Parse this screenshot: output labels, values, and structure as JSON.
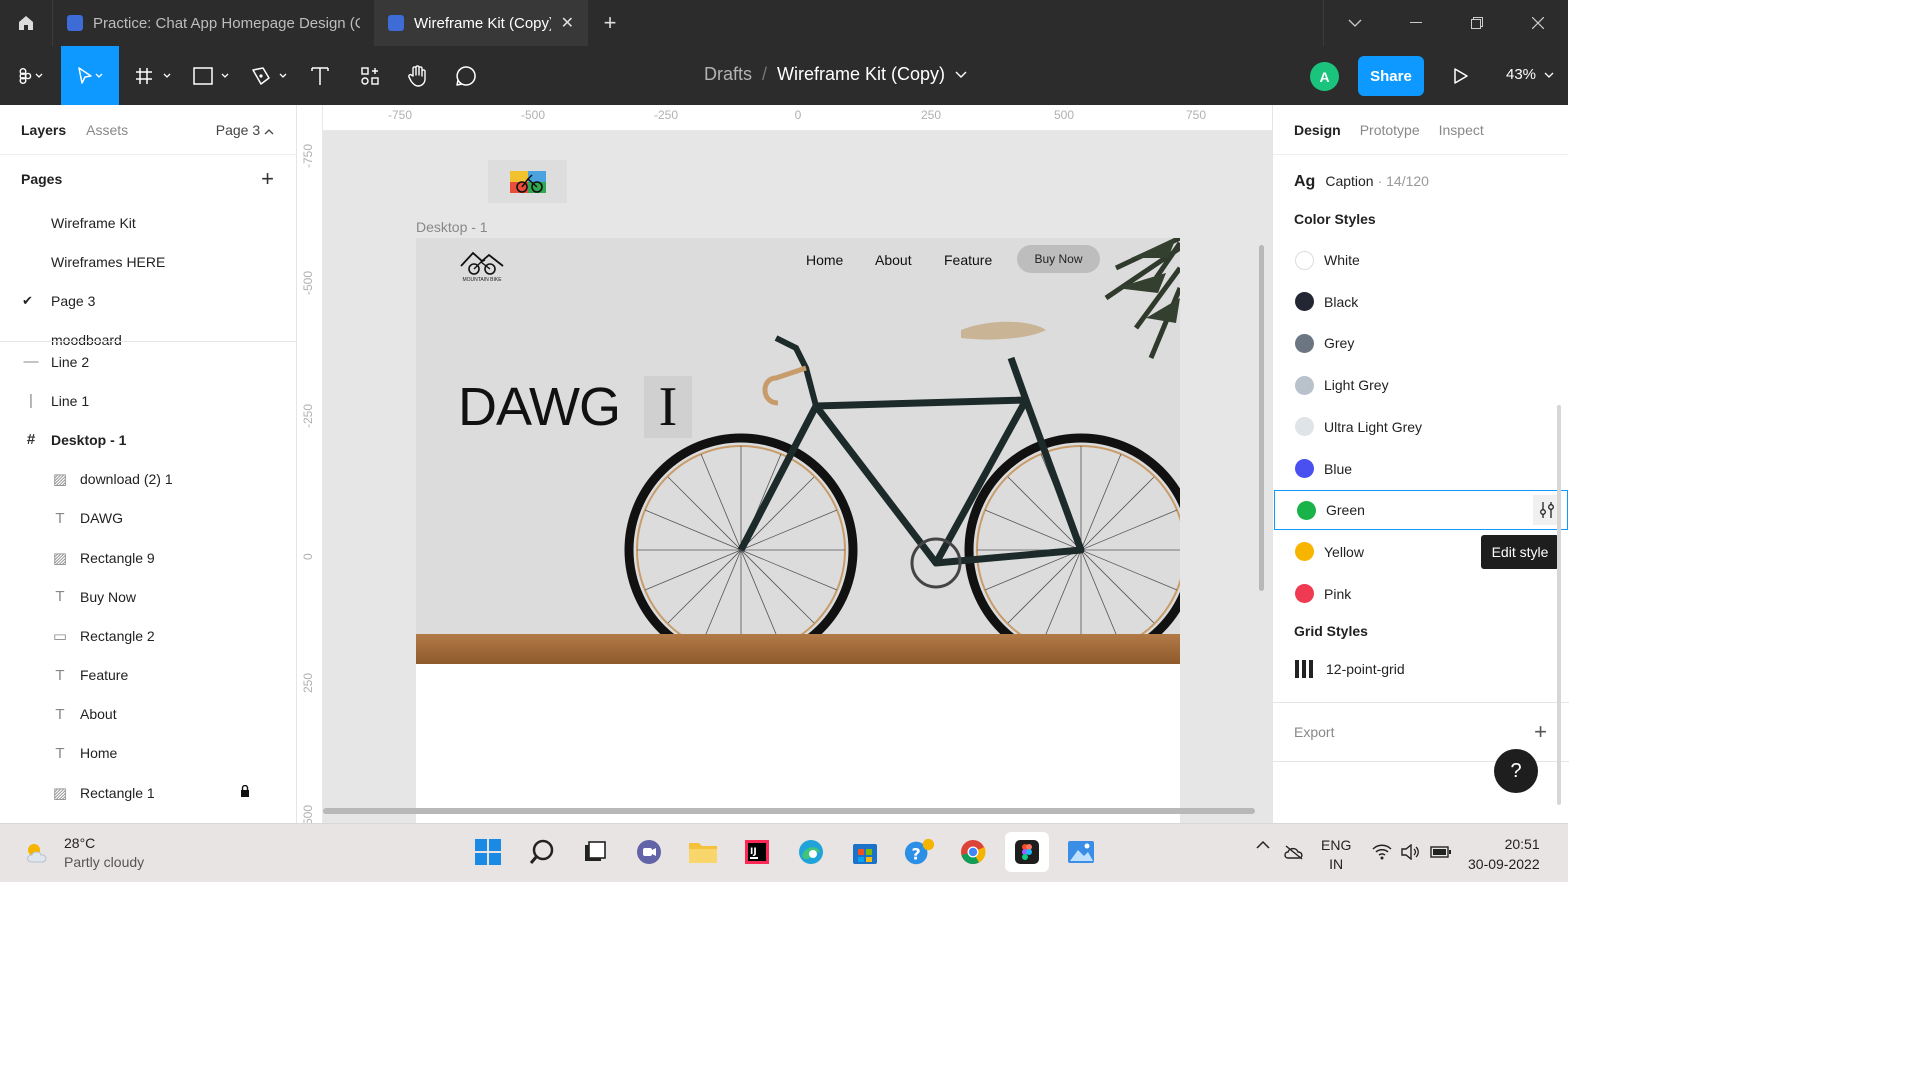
{
  "titlebar": {
    "tabs": [
      {
        "label": "Practice: Chat App Homepage Design (Co"
      },
      {
        "label": "Wireframe Kit (Copy)",
        "close": "✕"
      }
    ],
    "new_tab": "+"
  },
  "toolbar": {
    "breadcrumb": {
      "drafts": "Drafts",
      "sep": "/",
      "file": "Wireframe Kit (Copy)"
    },
    "avatar": "A",
    "share": "Share",
    "zoom": "43%"
  },
  "left_panel": {
    "tabs": {
      "layers": "Layers",
      "assets": "Assets",
      "page": "Page 3"
    },
    "pages_title": "Pages",
    "pages": [
      {
        "label": "Wireframe Kit",
        "current": false
      },
      {
        "label": "Wireframes HERE",
        "current": false
      },
      {
        "label": "Page 3",
        "current": true
      },
      {
        "label": "moodboard",
        "current": false
      }
    ],
    "layers": [
      {
        "label": "Line 2",
        "icon": "line-icon",
        "glyph": "—",
        "level": 0
      },
      {
        "label": "Line 1",
        "icon": "line-vertical-icon",
        "glyph": "|",
        "level": 0
      },
      {
        "label": "Desktop - 1",
        "icon": "frame-icon",
        "glyph": "#",
        "level": 0
      },
      {
        "label": "download (2) 1",
        "icon": "image-icon",
        "glyph": "▨",
        "level": 1
      },
      {
        "label": "DAWG",
        "icon": "text-icon",
        "glyph": "T",
        "level": 1
      },
      {
        "label": "Rectangle 9",
        "icon": "image-icon",
        "glyph": "▨",
        "level": 1
      },
      {
        "label": "Buy Now",
        "icon": "text-icon",
        "glyph": "T",
        "level": 1
      },
      {
        "label": "Rectangle 2",
        "icon": "rectangle-icon",
        "glyph": "▭",
        "level": 1
      },
      {
        "label": "Feature",
        "icon": "text-icon",
        "glyph": "T",
        "level": 1
      },
      {
        "label": "About",
        "icon": "text-icon",
        "glyph": "T",
        "level": 1
      },
      {
        "label": "Home",
        "icon": "text-icon",
        "glyph": "T",
        "level": 1
      },
      {
        "label": "Rectangle 1",
        "icon": "image-icon",
        "glyph": "▨",
        "level": 1,
        "locked": true
      }
    ]
  },
  "canvas": {
    "ruler_top": [
      "-750",
      "-500",
      "-250",
      "0",
      "250",
      "500",
      "750"
    ],
    "ruler_left": [
      "-750",
      "-500",
      "-250",
      "0",
      "250",
      "500"
    ],
    "frame_label": "Desktop - 1",
    "design": {
      "logo_text": "MOUNTAIN BIKE",
      "nav": [
        "Home",
        "About",
        "Feature"
      ],
      "buy_now": "Buy Now",
      "headline": "DAWG",
      "cursor_glyph": "I"
    }
  },
  "right_panel": {
    "tabs": {
      "design": "Design",
      "prototype": "Prototype",
      "inspect": "Inspect"
    },
    "text_style": {
      "ag": "Ag",
      "name": "Caption",
      "dim": "· 14/120"
    },
    "color_styles_title": "Color Styles",
    "color_styles": [
      {
        "name": "White",
        "color": "#ffffff"
      },
      {
        "name": "Black",
        "color": "#222733"
      },
      {
        "name": "Grey",
        "color": "#6b7682"
      },
      {
        "name": "Light Grey",
        "color": "#b9c2cb"
      },
      {
        "name": "Ultra Light Grey",
        "color": "#dfe4e9"
      },
      {
        "name": "Blue",
        "color": "#4a4ff0"
      },
      {
        "name": "Green",
        "color": "#1ab349",
        "selected": true
      },
      {
        "name": "Yellow",
        "color": "#f7b500"
      },
      {
        "name": "Pink",
        "color": "#ef3a52"
      }
    ],
    "tooltip": "Edit style",
    "grid_styles_title": "Grid Styles",
    "grid_style": "12-point-grid",
    "export": "Export",
    "help": "?"
  },
  "taskbar": {
    "weather": {
      "temp": "28°C",
      "desc": "Partly cloudy"
    },
    "lang": {
      "top": "ENG",
      "bottom": "IN"
    },
    "clock": {
      "time": "20:51",
      "date": "30-09-2022"
    }
  },
  "colors": {
    "accent": "#0d99ff",
    "dark_chrome": "#2c2c2c"
  }
}
